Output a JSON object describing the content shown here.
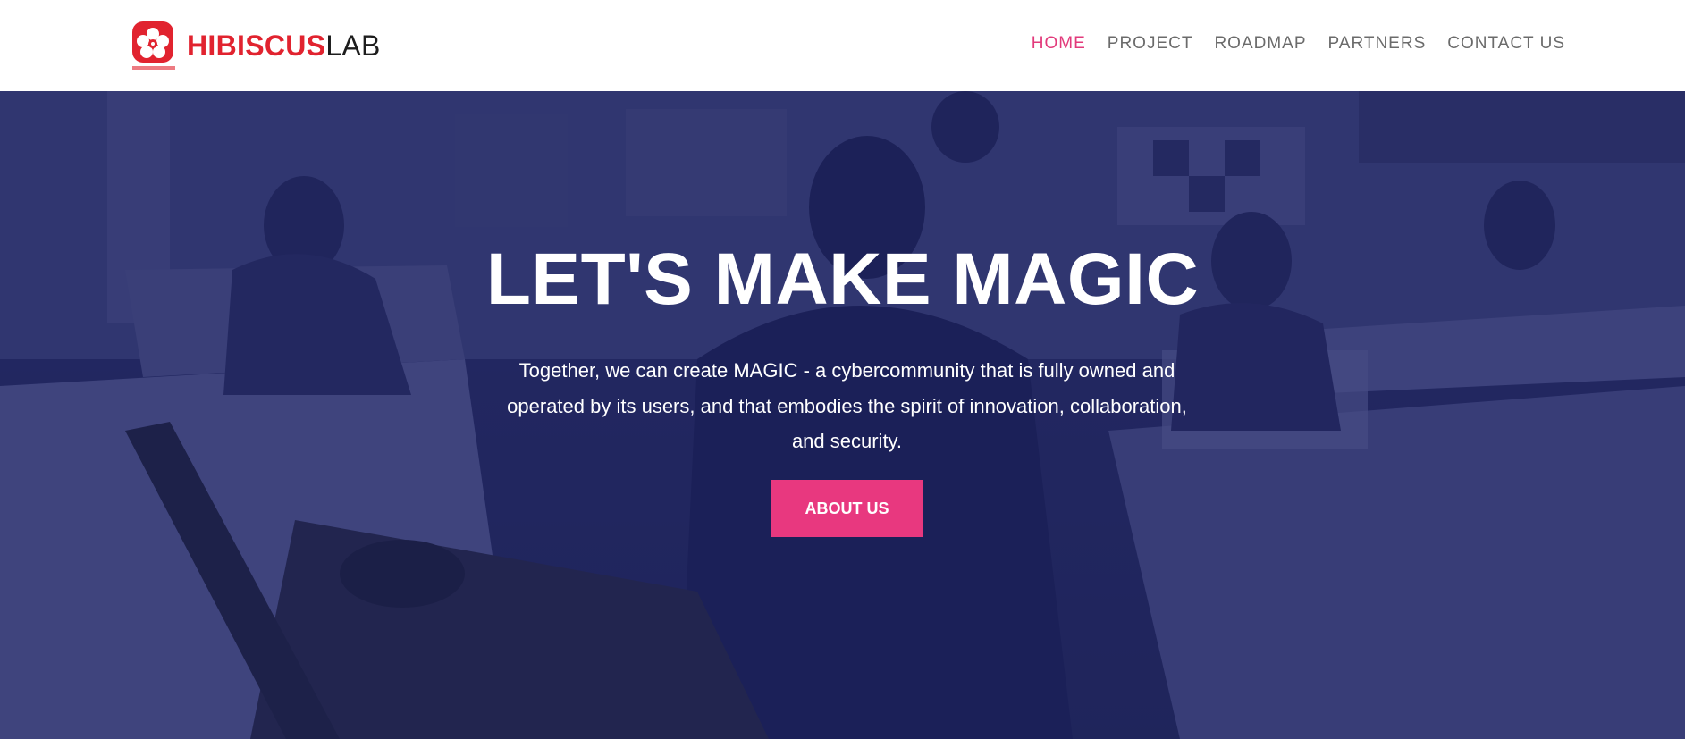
{
  "brand": {
    "name_primary": "HIBISCUS",
    "name_secondary": "LAB",
    "logo_icon": "hibiscus-flower-icon",
    "logo_caption": "HIBISCUS LAB",
    "primary_color": "#e1232f"
  },
  "nav": {
    "items": [
      {
        "label": "HOME",
        "active": true
      },
      {
        "label": "PROJECT",
        "active": false
      },
      {
        "label": "ROADMAP",
        "active": false
      },
      {
        "label": "PARTNERS",
        "active": false
      },
      {
        "label": "CONTACT US",
        "active": false
      }
    ],
    "active_color": "#e23a7b"
  },
  "hero": {
    "title": "LET'S MAKE MAGIC",
    "text": "Together, we can create MAGIC - a cybercommunity that is fully owned and operated by its users, and that embodies the spirit of innovation, collaboration, and security.",
    "button_label": "ABOUT US",
    "button_color": "#e8387f",
    "overlay_color": "#1b215f"
  }
}
